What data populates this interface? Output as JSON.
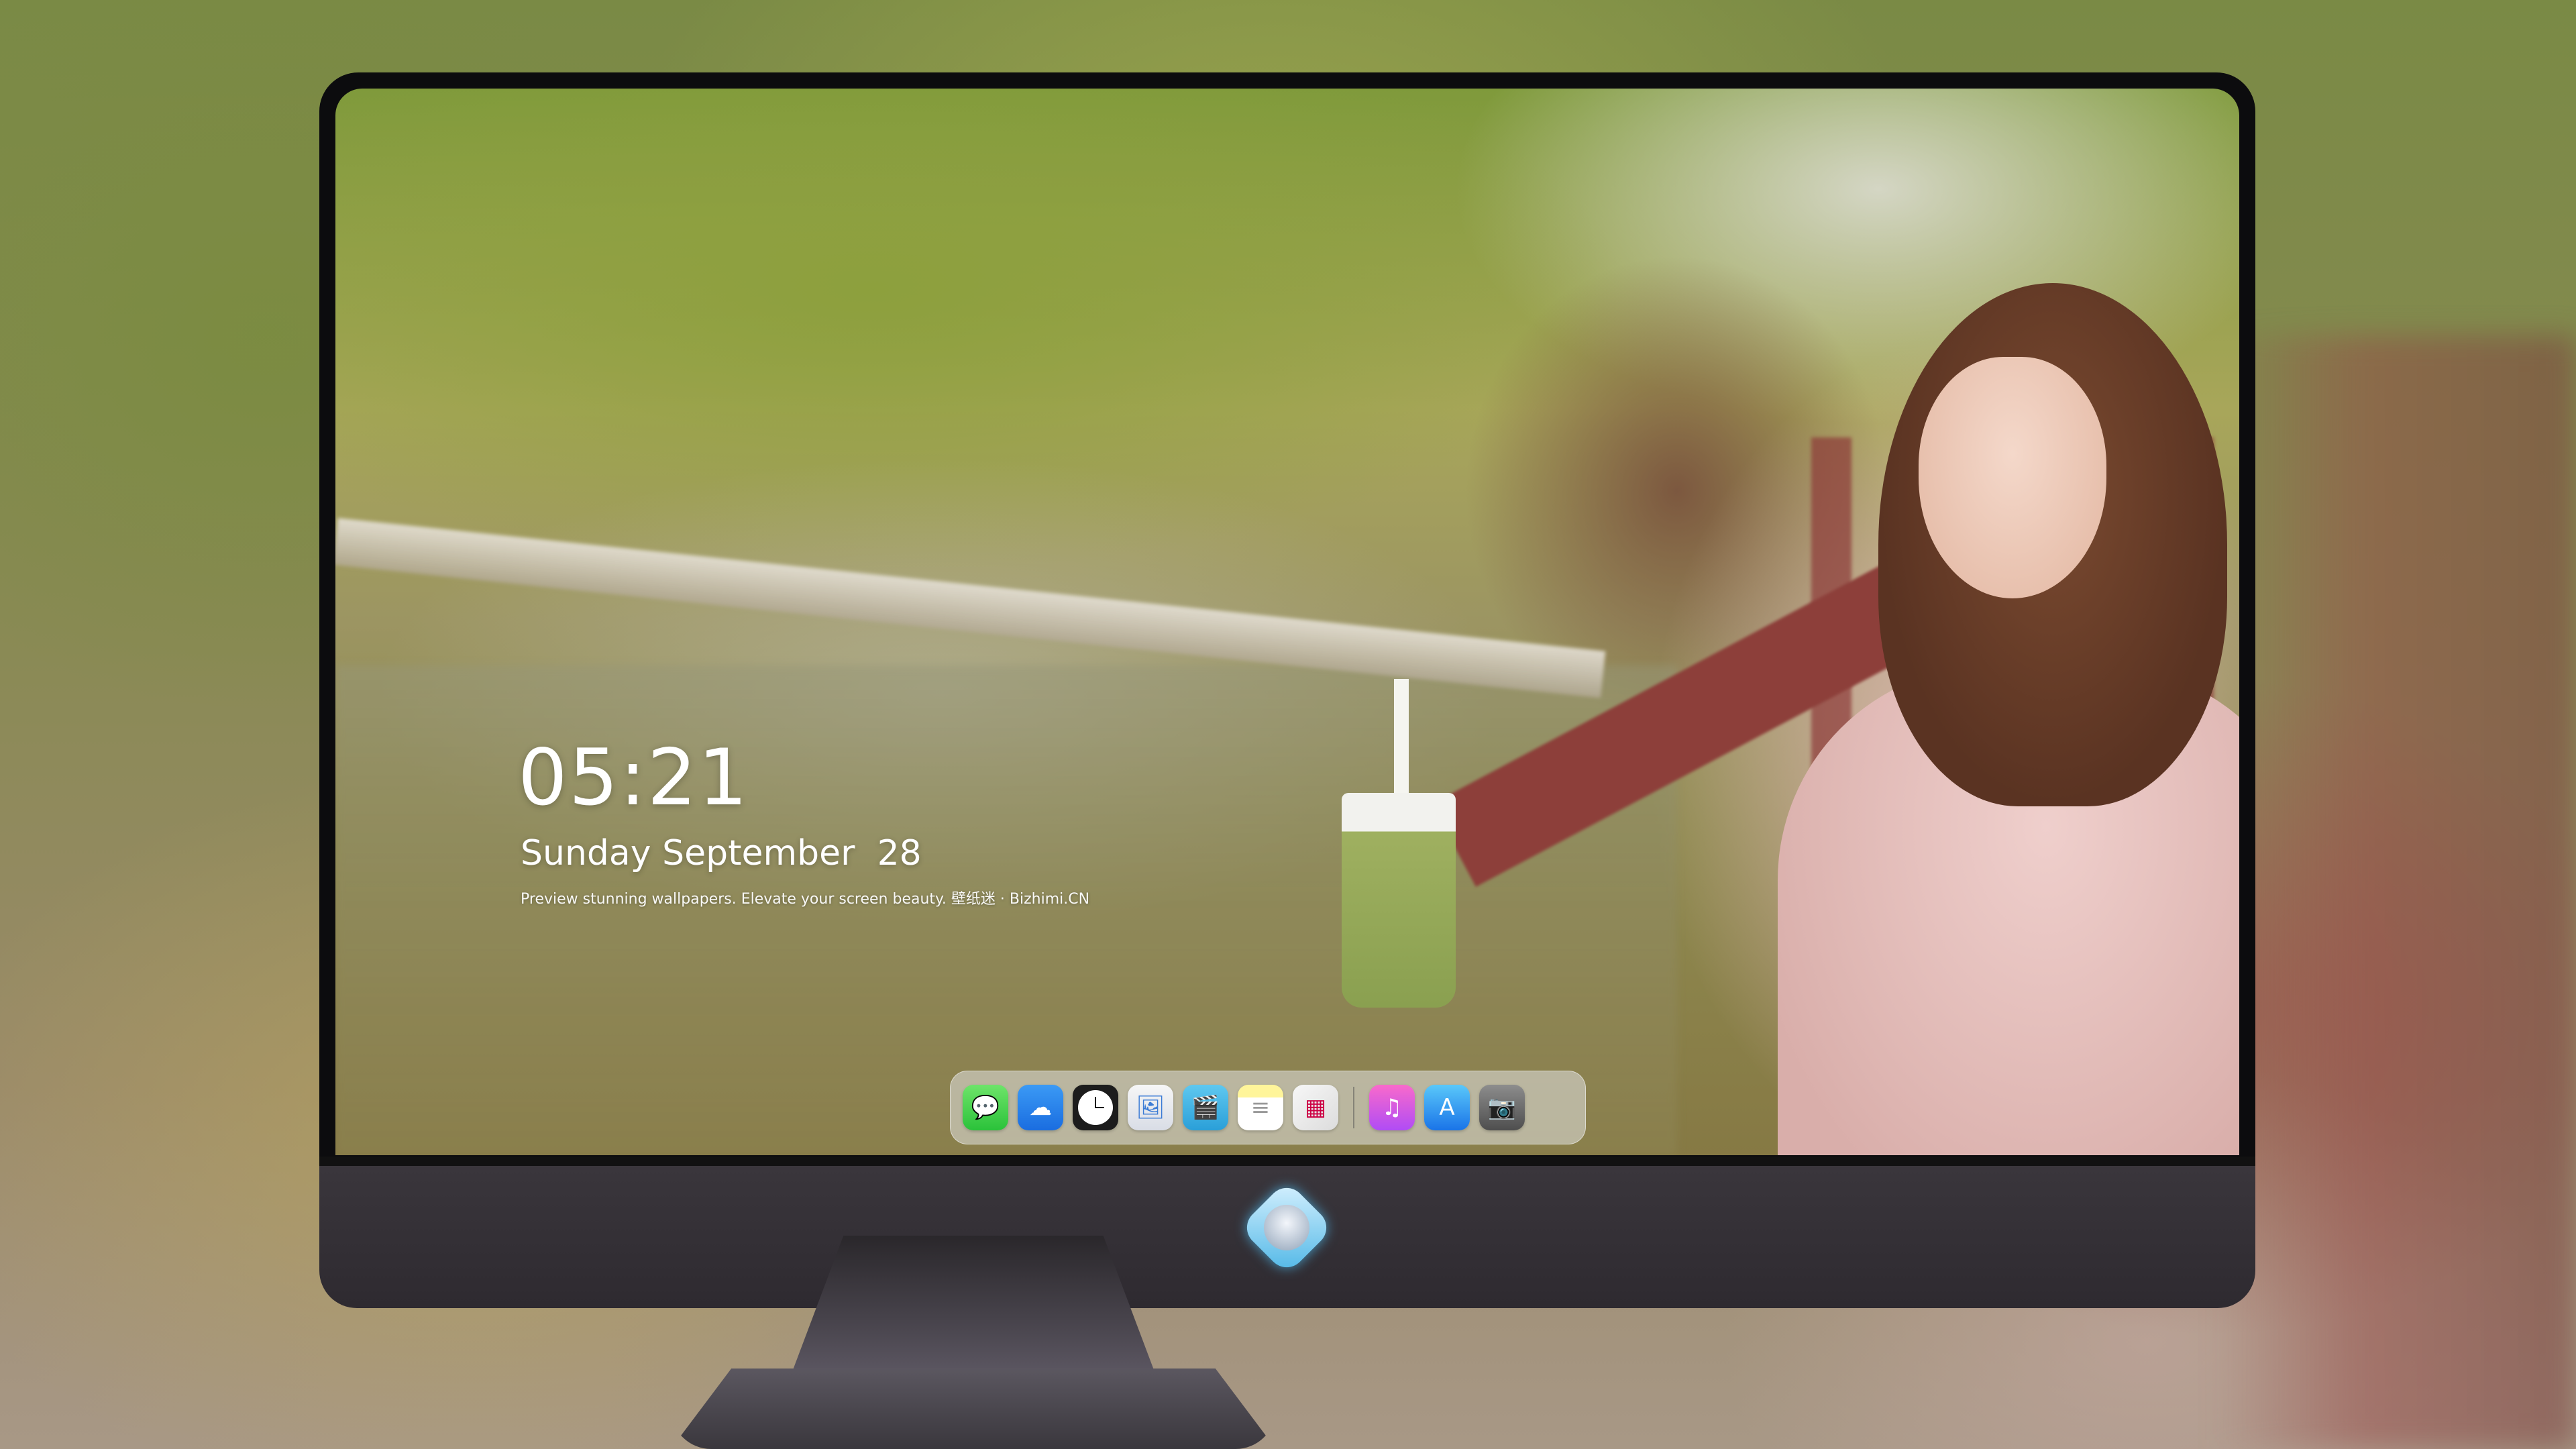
{
  "clock": {
    "time": "05:21",
    "date": "Sunday September  28",
    "tagline": "Preview stunning wallpapers. Elevate your screen beauty. 壁纸迷 · Bizhimi.CN"
  },
  "dock": {
    "items": [
      {
        "name": "messages",
        "icon": "messages-icon",
        "glyph": "💬"
      },
      {
        "name": "weather",
        "icon": "weather-icon",
        "glyph": "☁"
      },
      {
        "name": "clock",
        "icon": "clock-icon",
        "glyph": ""
      },
      {
        "name": "preview",
        "icon": "preview-icon",
        "glyph": "🖼"
      },
      {
        "name": "clips",
        "icon": "clapperboard-icon",
        "glyph": "🎬"
      },
      {
        "name": "notes",
        "icon": "notes-icon",
        "glyph": "≡"
      },
      {
        "name": "photo-booth",
        "icon": "gallery-icon",
        "glyph": "▦"
      },
      {
        "name": "music",
        "icon": "music-icon",
        "glyph": "♫"
      },
      {
        "name": "app-store",
        "icon": "app-store-icon",
        "glyph": "A"
      },
      {
        "name": "camera",
        "icon": "camera-icon",
        "glyph": "📷"
      }
    ]
  },
  "colors": {
    "clock_text": "#ffffff",
    "bezel": "#0c0c0e",
    "chin": "#3a363c"
  }
}
